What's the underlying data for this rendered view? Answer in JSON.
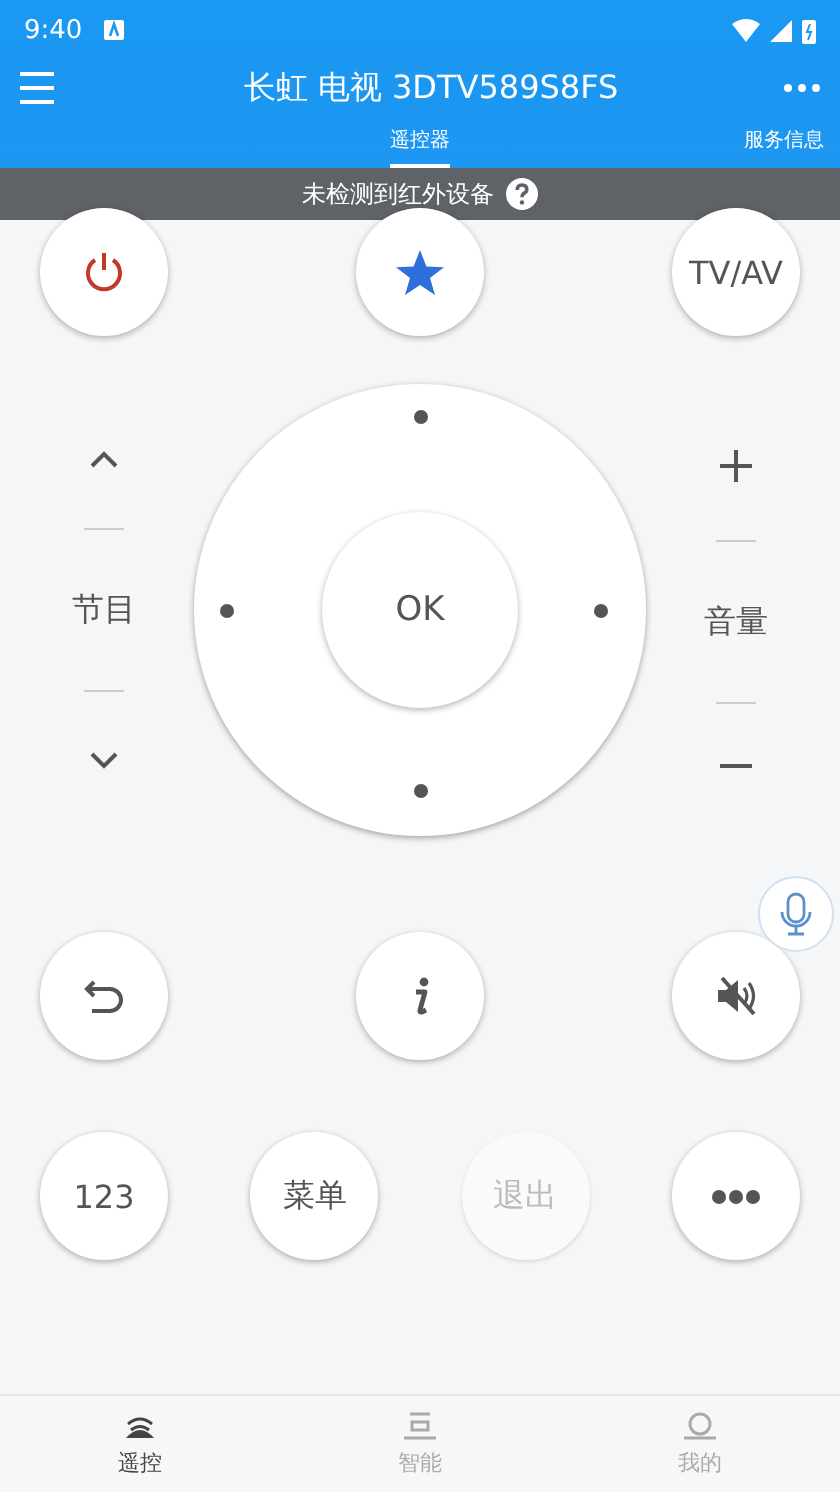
{
  "status_bar": {
    "time": "9:40"
  },
  "app_bar": {
    "title": "长虹 电视 3DTV589S8FS"
  },
  "tabs": [
    {
      "label": "遥控器",
      "selected": true
    },
    {
      "label": "服务信息",
      "selected": false
    }
  ],
  "notice": {
    "text": "未检测到红外设备"
  },
  "top_buttons": [
    {
      "kind": "power",
      "disabled": false
    },
    {
      "kind": "favorite",
      "disabled": false
    },
    {
      "kind": "text",
      "label": "TV/AV",
      "disabled": false
    }
  ],
  "channel": {
    "label": "节目"
  },
  "volume": {
    "label": "音量"
  },
  "dpad": {
    "ok": "OK"
  },
  "middle_buttons": [
    {
      "kind": "back",
      "disabled": false
    },
    {
      "kind": "info",
      "disabled": false
    },
    {
      "kind": "mute",
      "disabled": false
    }
  ],
  "bottom_buttons": [
    {
      "kind": "text",
      "label": "123",
      "disabled": false
    },
    {
      "kind": "text",
      "label": "菜单",
      "disabled": false
    },
    {
      "kind": "text",
      "label": "退出",
      "disabled": true
    },
    {
      "kind": "more",
      "disabled": false
    }
  ],
  "nav": [
    {
      "kind": "remote",
      "label": "遥控",
      "selected": true
    },
    {
      "kind": "smart",
      "label": "智能",
      "selected": false
    },
    {
      "kind": "profile",
      "label": "我的",
      "selected": false
    }
  ]
}
